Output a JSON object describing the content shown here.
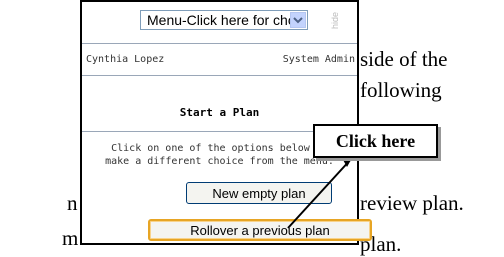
{
  "document": {
    "right_line1": "side of the",
    "right_line2": "following",
    "right_line3": "review plan.",
    "right_line4": "plan.",
    "left_line1": "n",
    "left_line2": "m"
  },
  "menu": {
    "selected": "Menu-Click here for choices",
    "arrow_icon": "chevron-down-icon"
  },
  "hide_label": "hide",
  "user": {
    "name": "Cynthia Lopez",
    "role": "System Admin"
  },
  "main": {
    "title": "Start a Plan",
    "help_line1": "Click on one of the options below or",
    "help_line2": "make a different choice from the menu.",
    "new_plan_label": "New empty plan",
    "rollover_label": "Rollover a previous plan"
  },
  "callout": {
    "label": "Click here"
  },
  "colors": {
    "focus_border": "#e7a524",
    "button_border": "#003c74",
    "select_border": "#7f9db9"
  }
}
